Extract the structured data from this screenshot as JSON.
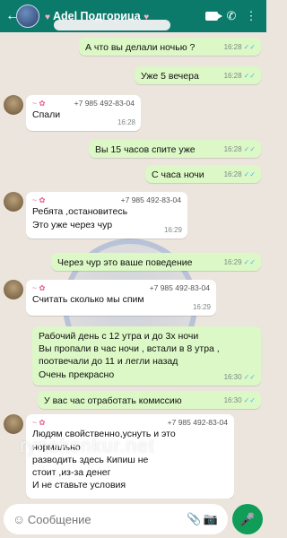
{
  "header": {
    "title": "Adel Подгорица"
  },
  "messages": [
    {
      "text": "А что вы делали ночью ?",
      "time": "16:28"
    },
    {
      "text": "Уже 5 вечера",
      "time": "16:28"
    },
    {
      "phone": "+7 985 492-83-04",
      "text": "Спали",
      "time": "16:28"
    },
    {
      "text": "Вы 15 часов спите уже",
      "time": "16:28"
    },
    {
      "text": "С часа ночи",
      "time": "16:28"
    },
    {
      "phone": "+7 985 492-83-04",
      "line1": "Ребята ,остановитесь",
      "line2": "Это уже через чур",
      "time": "16:29"
    },
    {
      "text": "Через чур это ваше поведение",
      "time": "16:29"
    },
    {
      "phone": "+7 985 492-83-04",
      "text": "Считать сколько мы спим",
      "time": "16:29"
    },
    {
      "line1": "Рабочий день с 12 утра и до 3х ночи",
      "line2": "Вы пропали в час ночи , встали в 8 утра ,",
      "line3": "поотвечали до 11 и легли назад",
      "line4": "Очень прекрасно",
      "time": "16:30"
    },
    {
      "text": "У вас час отработать комиссию",
      "time": "16:30"
    },
    {
      "phone": "+7 985 492-83-04",
      "line1": "Людям свойственно,уснуть и это",
      "line2": "нормально",
      "line3": "разводить здесь Кипиш не",
      "line4": "стоит ,из-за денег",
      "line5": "И не ставьте условия"
    }
  ],
  "watermark": "rynoksnkur.net",
  "input": {
    "placeholder": "Сообщение"
  }
}
